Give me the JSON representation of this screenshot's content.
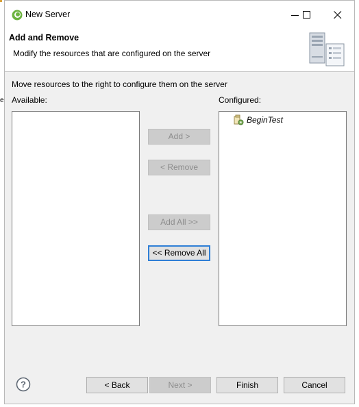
{
  "window": {
    "title": "New Server"
  },
  "banner": {
    "title": "Add and Remove",
    "description": "Modify the resources that are configured on the server"
  },
  "content": {
    "instruction": "Move resources to the right to configure them on the server",
    "available_label": "Available:",
    "configured_label": "Configured:",
    "available_items": [],
    "configured_items": [
      {
        "label": "BeginTest",
        "icon": "project-icon"
      }
    ]
  },
  "transfer_buttons": {
    "add": "Add >",
    "remove": "< Remove",
    "add_all": "Add All >>",
    "remove_all": "<< Remove All"
  },
  "footer": {
    "back": "< Back",
    "next": "Next >",
    "finish": "Finish",
    "cancel": "Cancel"
  },
  "colors": {
    "focus_border": "#2f7fd6",
    "disabled_text": "#8c8c8c",
    "dialog_background": "#f0f0f0"
  }
}
